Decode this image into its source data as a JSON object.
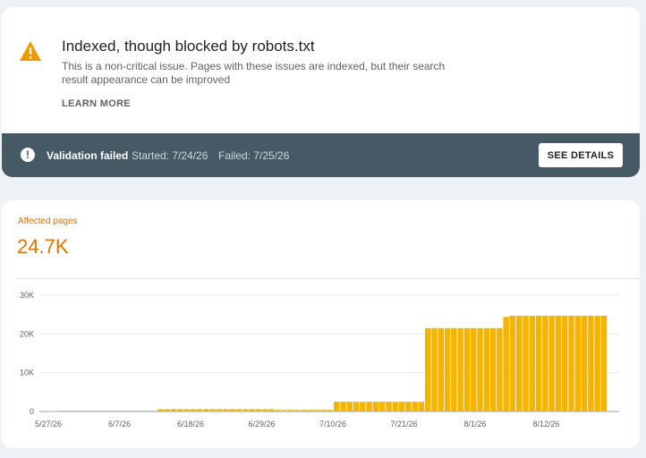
{
  "issue": {
    "title": "Indexed, though blocked by robots.txt",
    "description": "This is a non-critical issue. Pages with these issues are indexed, but their search result appearance can be improved",
    "learn_more": "LEARN MORE",
    "icon": "warning-icon"
  },
  "validation": {
    "status": "Validation failed",
    "started": "Started: 7/24/26",
    "failed": "Failed: 7/25/26",
    "button": "SEE DETAILS",
    "icon": "alert-circle-icon"
  },
  "metric": {
    "label": "Affected pages",
    "value": "24.7K",
    "color": "#e37400"
  },
  "colors": {
    "bar": "#f4b400",
    "validation_bar": "#455a64",
    "warning": "#f29900"
  },
  "chart_data": {
    "type": "bar",
    "y_ticks": [
      "30K",
      "20K",
      "10K",
      "0"
    ],
    "x_ticks": [
      "5/27/26",
      "6/7/26",
      "6/18/26",
      "6/29/26",
      "7/10/26",
      "7/21/26",
      "8/1/26",
      "8/12/26"
    ],
    "ylim": [
      0,
      30000
    ],
    "grid": true,
    "series": [
      {
        "values": [
          200,
          200,
          200,
          200,
          200,
          200,
          200,
          200,
          200,
          200,
          200,
          200,
          200,
          200,
          200,
          600,
          600,
          600,
          600,
          600,
          600,
          600,
          600,
          600,
          600,
          600,
          600,
          600,
          600,
          600,
          600,
          600,
          600,
          400,
          400,
          400,
          400,
          400,
          400,
          400,
          400,
          400,
          2500,
          2500,
          2500,
          2500,
          2500,
          2500,
          2500,
          2500,
          2500,
          2500,
          2500,
          2500,
          2500,
          2500,
          21500,
          21500,
          21500,
          21500,
          21500,
          21500,
          21500,
          21500,
          21500,
          21500,
          21500,
          21500,
          24400,
          24700,
          24700,
          24700,
          24700,
          24700,
          24700,
          24700,
          24700,
          24700,
          24700,
          24700,
          24700,
          24700,
          24700,
          24700
        ]
      }
    ]
  }
}
